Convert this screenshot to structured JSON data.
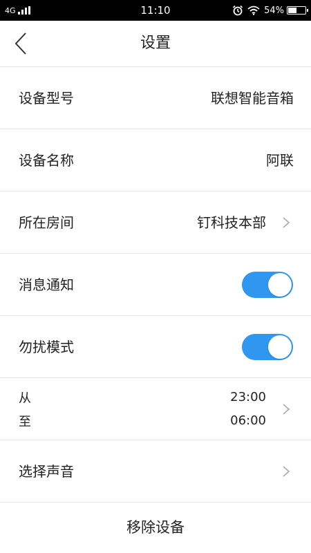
{
  "status_bar": {
    "network": "4G",
    "time": "11:10",
    "battery_text": "54%",
    "battery_level": 0.54,
    "icons": [
      "signal-icon",
      "alarm-icon",
      "wifi-icon",
      "battery-icon"
    ]
  },
  "header": {
    "title": "设置",
    "back_icon": "chevron-left-icon"
  },
  "settings": {
    "model": {
      "label": "设备型号",
      "value": "联想智能音箱"
    },
    "name": {
      "label": "设备名称",
      "value": "阿联"
    },
    "room": {
      "label": "所在房间",
      "value": "钉科技本部"
    },
    "notification": {
      "label": "消息通知",
      "on": true
    },
    "dnd": {
      "label": "勿扰模式",
      "on": true
    },
    "dnd_time": {
      "from_label": "从",
      "from_value": "23:00",
      "to_label": "至",
      "to_value": "06:00"
    },
    "sound": {
      "label": "选择声音"
    }
  },
  "actions": {
    "remove_label": "移除设备"
  },
  "colors": {
    "toggle_on": "#2f97f0",
    "status_bar": "#000000",
    "divider": "#e6e6e6"
  }
}
